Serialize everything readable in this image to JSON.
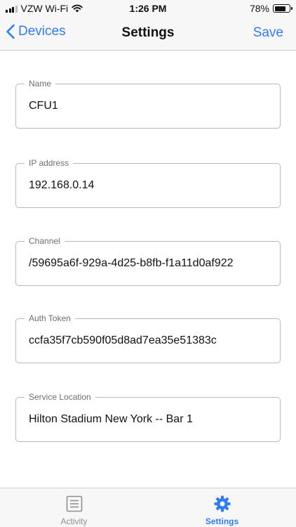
{
  "status_bar": {
    "carrier": "VZW Wi-Fi",
    "time": "1:26 PM",
    "battery_percent": "78%",
    "battery_level": 0.78,
    "icons": [
      "signal-icon",
      "wifi-icon",
      "battery-icon"
    ]
  },
  "nav": {
    "back_label": "Devices",
    "title": "Settings",
    "save_label": "Save"
  },
  "form": {
    "fields": [
      {
        "label": "Name",
        "value": "CFU1"
      },
      {
        "label": "IP address",
        "value": "192.168.0.14"
      },
      {
        "label": "Channel",
        "value": "/59695a6f-929a-4d25-b8fb-f1a11d0af922"
      },
      {
        "label": "Auth Token",
        "value": "ccfa35f7cb590f05d8ad7ea35e51383c"
      },
      {
        "label": "Service Location",
        "value": "Hilton Stadium New York -- Bar 1"
      }
    ]
  },
  "tab_bar": {
    "tabs": [
      {
        "label": "Activity",
        "icon": "list-icon",
        "active": false
      },
      {
        "label": "Settings",
        "icon": "gear-icon",
        "active": true
      }
    ]
  },
  "colors": {
    "accent": "#2f7cf6",
    "inactive_tab": "#8e8e93",
    "field_border": "#b9b9b9",
    "bar_background": "#f7f7f7"
  }
}
